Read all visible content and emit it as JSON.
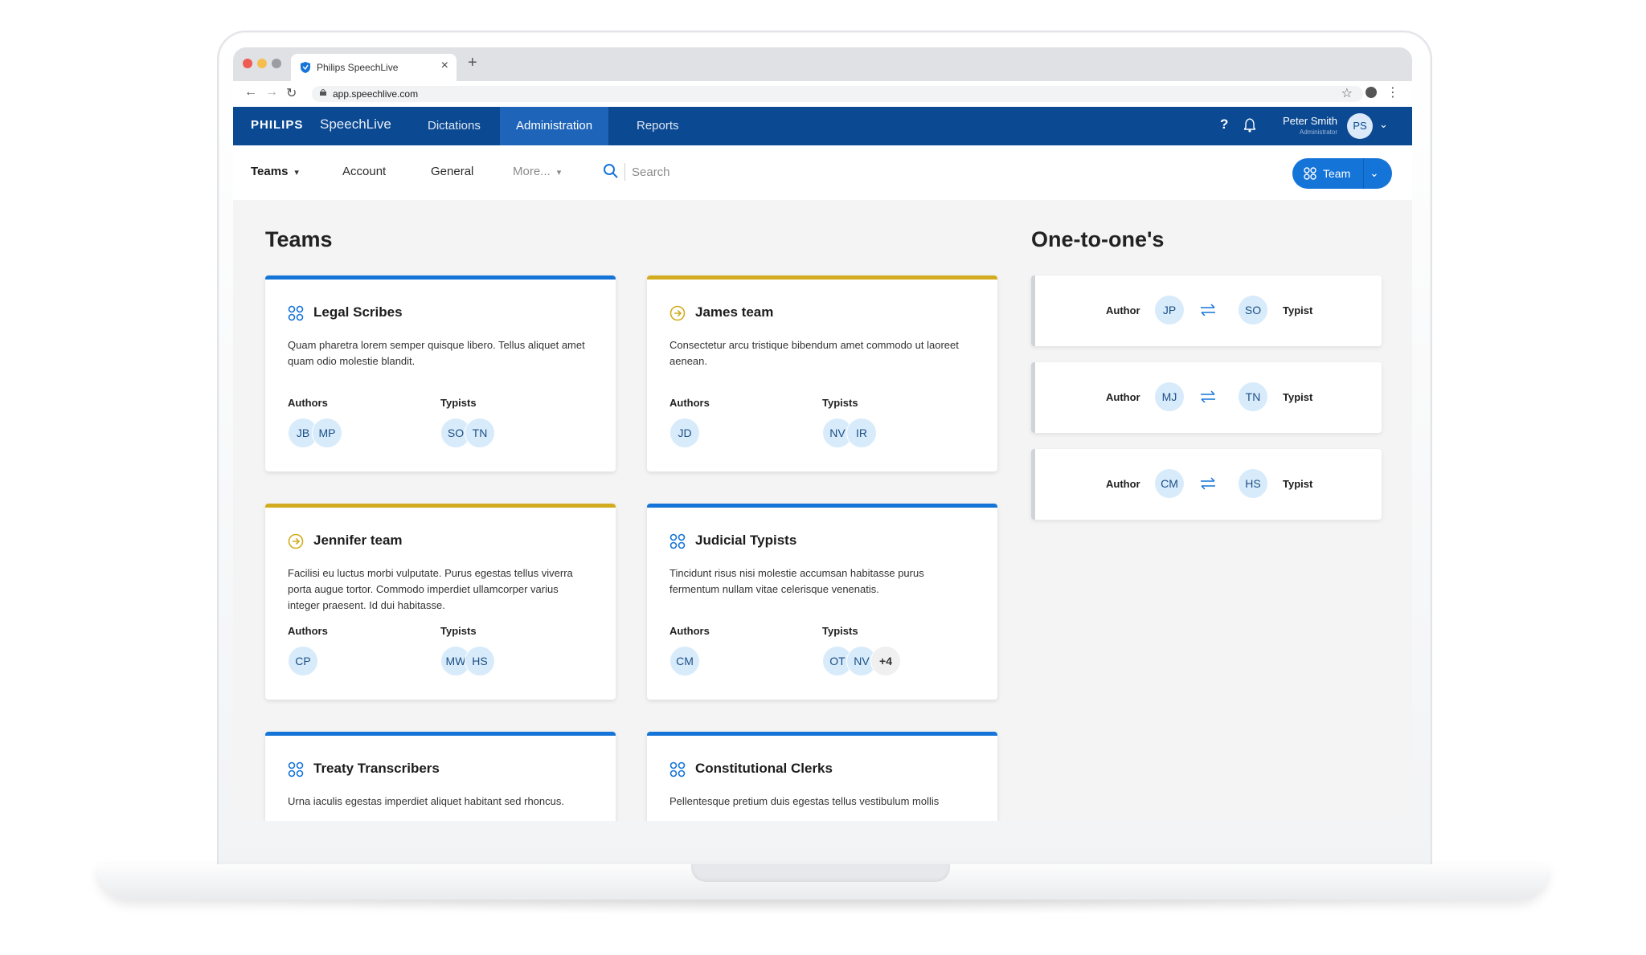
{
  "browser": {
    "tab_title": "Philips SpeechLive",
    "url": "app.speechlive.com"
  },
  "app": {
    "brand": "PHILIPS",
    "product": "SpeechLive",
    "nav": [
      "Dictations",
      "Administration",
      "Reports"
    ],
    "active_nav": "Administration",
    "user": {
      "name": "Peter Smith",
      "role": "Administrator",
      "initials": "PS"
    }
  },
  "subnav": {
    "items": [
      "Teams",
      "Account",
      "General",
      "More..."
    ],
    "search_placeholder": "Search",
    "team_button": "Team"
  },
  "teams": {
    "heading": "Teams",
    "authors_label": "Authors",
    "typists_label": "Typists",
    "cards": [
      {
        "name": "Legal Scribes",
        "icon": "team-icon",
        "desc": "Quam pharetra lorem semper quisque libero. Tellus aliquet amet quam odio molestie blandit.",
        "authors": [
          "JB",
          "MP"
        ],
        "typists": [
          "SO",
          "TN"
        ]
      },
      {
        "name": "James team",
        "icon": "arrow-circle-icon",
        "desc": "Consectetur arcu tristique bibendum amet commodo ut laoreet aenean.",
        "authors": [
          "JD"
        ],
        "typists": [
          "NV",
          "IR"
        ]
      },
      {
        "name": "Jennifer team",
        "icon": "arrow-circle-icon",
        "desc": "Facilisi eu luctus morbi vulputate. Purus egestas tellus viverra porta augue tortor. Commodo imperdiet ullamcorper varius integer praesent. Id dui habitasse.",
        "authors": [
          "CP"
        ],
        "typists": [
          "MW",
          "HS"
        ]
      },
      {
        "name": "Judicial Typists",
        "icon": "team-icon",
        "desc": "Tincidunt risus nisi molestie accumsan habitasse purus fermentum nullam vitae celerisque venenatis.",
        "authors": [
          "CM"
        ],
        "typists": [
          "OT",
          "NV",
          "+4"
        ]
      },
      {
        "name": "Treaty Transcribers",
        "icon": "team-icon",
        "desc": "Urna iaculis egestas imperdiet aliquet habitant sed rhoncus."
      },
      {
        "name": "Constitutional Clerks",
        "icon": "team-icon",
        "desc": "Pellentesque pretium duis egestas tellus vestibulum mollis"
      }
    ]
  },
  "one_to_ones": {
    "heading": "One-to-one's",
    "author_label": "Author",
    "typist_label": "Typist",
    "pairs": [
      {
        "author": "JP",
        "typist": "SO"
      },
      {
        "author": "MJ",
        "typist": "TN"
      },
      {
        "author": "CM",
        "typist": "HS"
      }
    ]
  },
  "colors": {
    "brand_blue": "#0b4a93",
    "accent_blue": "#1474d8",
    "accent_yellow": "#d2ac1e",
    "avatar_bg": "#d8ebfb"
  }
}
